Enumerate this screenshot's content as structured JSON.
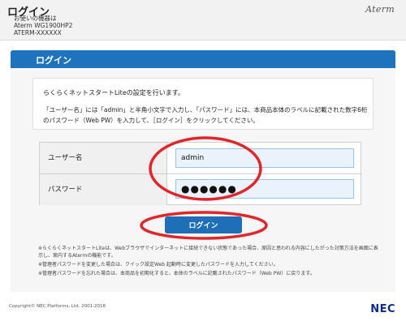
{
  "header": {
    "title": "ログイン",
    "device_label": "お使いの機器は",
    "model": "Aterm WG1900HP2",
    "device_name": "ATERM-XXXXXX",
    "brand": "Aterm"
  },
  "section": {
    "title": "ログイン"
  },
  "info": {
    "line1": "らくらくネットスタートLiteの設定を行います。",
    "line2": "「ユーザー名」には「admin」と半角小文字で入力し、「パスワード」には、本商品本体のラベルに記載された数字6桁のパスワード（Web PW）を入力して、［ログイン］をクリックしてください。"
  },
  "form": {
    "username_label": "ユーザー名",
    "username_value": "admin",
    "password_label": "パスワード",
    "password_value": "●●●●●●",
    "login_button": "ログイン"
  },
  "notes": [
    "※らくらくネットスタートLiteは、Webブラウザでインターネットに接続できない状態であった場合、原因と思われる内容にしたがった対策方法を画面に表示し、案内するAtermの機能です。",
    "※管理者パスワードを変更した場合は、クイック設定Web 起動時に変更したパスワードを入力してください。",
    "※管理者パスワードを忘れた場合は、本商品を初期化すると、本体のラベルに記載されたパスワード（Web PW）に戻ります。"
  ],
  "footer": {
    "copyright": "Copyright© NEC Platforms, Ltd. 2001-2018",
    "logo": "NEC"
  },
  "colors": {
    "accent": "#1e73be",
    "annotation": "#e0262a",
    "field_bg": "#eaf3fb"
  }
}
